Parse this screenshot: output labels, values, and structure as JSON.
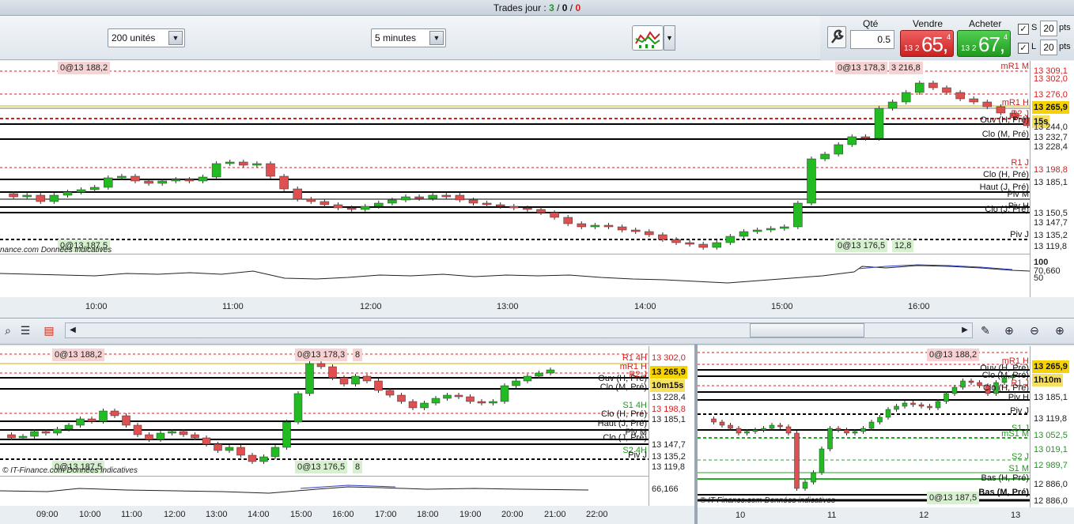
{
  "header": {
    "trades_label": "Trades jour : ",
    "trades_a": "3",
    "trades_sep1": " / ",
    "trades_b": "0",
    "trades_sep2": " / ",
    "trades_c": "0"
  },
  "toolbar": {
    "quantity_select": "200 unités",
    "interval_select": "5 minutes"
  },
  "order": {
    "qty_label": "Qté",
    "qty_value": "0.5",
    "sell_label": "Vendre",
    "buy_label": "Acheter",
    "sell_prefix": "13 2",
    "sell_price": "65,",
    "sell_sup": "4",
    "buy_prefix": "13 2",
    "buy_price": "67,",
    "buy_sup": "4",
    "stop_label": "S",
    "limit_label": "L",
    "stop_pts": "20",
    "limit_pts": "20",
    "pts_label": "pts"
  },
  "colors": {
    "up": "#22bb22",
    "down": "#e05050",
    "resist": "#d02020",
    "support": "#22aa22",
    "pivot": "#000000",
    "price_hl": "#f5d200"
  },
  "main_chart": {
    "y_labels": [
      "13 309,1",
      "13 302,0",
      "13 276,0",
      "13 265,9",
      "13 244,0",
      "13 232,7",
      "13 228,4",
      "13 198,8",
      "13 185,1",
      "13 150,5",
      "13 147,7",
      "13 135,2",
      "13 119,8"
    ],
    "current_price": "13 265,9",
    "timer": "15s",
    "levels": [
      "mR1 M",
      "mR1 H",
      "R2 J",
      "Ouv (H, Pré)",
      "Clo (M, Pré)",
      "R1 J",
      "Clo (H, Pré)",
      "Haut (J, Pré)",
      "Piv M",
      "Piv H",
      "Clo (J, Pré)",
      "Piv J"
    ],
    "tags": [
      "0@13 188,2",
      "0@13 178,3",
      "3 216,8",
      "0@13 187,5",
      "0@13 176,5",
      "12,8"
    ],
    "time_labels": [
      "10:00",
      "11:00",
      "12:00",
      "13:00",
      "14:00",
      "15:00",
      "16:00"
    ],
    "footer": "nance.com  Données indicatives",
    "osc_labels": [
      "100",
      "70,660",
      "50"
    ]
  },
  "bottom_left": {
    "y_labels": [
      "13 302,0",
      "13 265,9",
      "13 228,4",
      "13 198,8",
      "13 185,1",
      "13 147,7",
      "13 135,2",
      "13 119,8"
    ],
    "current_price": "13 265,9",
    "timer": "10m15s",
    "levels": [
      "R1 4H",
      "mR1 H",
      "R2 J",
      "Ouv (H, Pré)",
      "Clo (M, Pré)",
      "S1 4H",
      "Clo (H, Pré)",
      "Haut (J, Pré)",
      "Piv M",
      "Clo (J, Pré)",
      "S2 4H",
      "Piv J"
    ],
    "tags": [
      "0@13 188,2",
      "0@13 178,3",
      "8",
      "0@13 187,5",
      "0@13 176,5",
      "8"
    ],
    "time_labels": [
      "09:00",
      "10:00",
      "11:00",
      "12:00",
      "13:00",
      "14:00",
      "15:00",
      "16:00",
      "17:00",
      "18:00",
      "19:00",
      "20:00",
      "21:00",
      "22:00"
    ],
    "footer": "© IT-Finance.com  Données indicatives",
    "osc_label": "66,166"
  },
  "bottom_right": {
    "y_labels": [
      "13 265,9",
      "13 185,1",
      "13 119,8",
      "13 052,5",
      "13 019,1",
      "12 989,7",
      "12 886,0"
    ],
    "current_price": "13 265,9",
    "timer": "1h10m",
    "levels": [
      "mR1 H",
      "Ouv (H, Pré)",
      "Clo (M, Pré)",
      "R1 J",
      "Clo (H, Pré)",
      "Piv H",
      "Piv J",
      "S1 J",
      "mS1 M",
      "S2 J",
      "S1 M",
      "Bas (H, Pré)",
      "Bas (M, Pré)"
    ],
    "tags": [
      "0@13 188,2",
      "0@13 187,5"
    ],
    "time_labels": [
      "10",
      "11",
      "12",
      "13"
    ],
    "footer": "© IT-Finance.com  Données indicatives"
  },
  "icons": [
    "zoom-icon",
    "list-icon",
    "bars-icon",
    "scroll-left-icon",
    "scroll-right-icon",
    "tool-icon",
    "zoom-fit-icon",
    "zoom-out-icon",
    "zoom-in-icon",
    "wrench-icon",
    "check-icon",
    "chart-tool-icon"
  ]
}
